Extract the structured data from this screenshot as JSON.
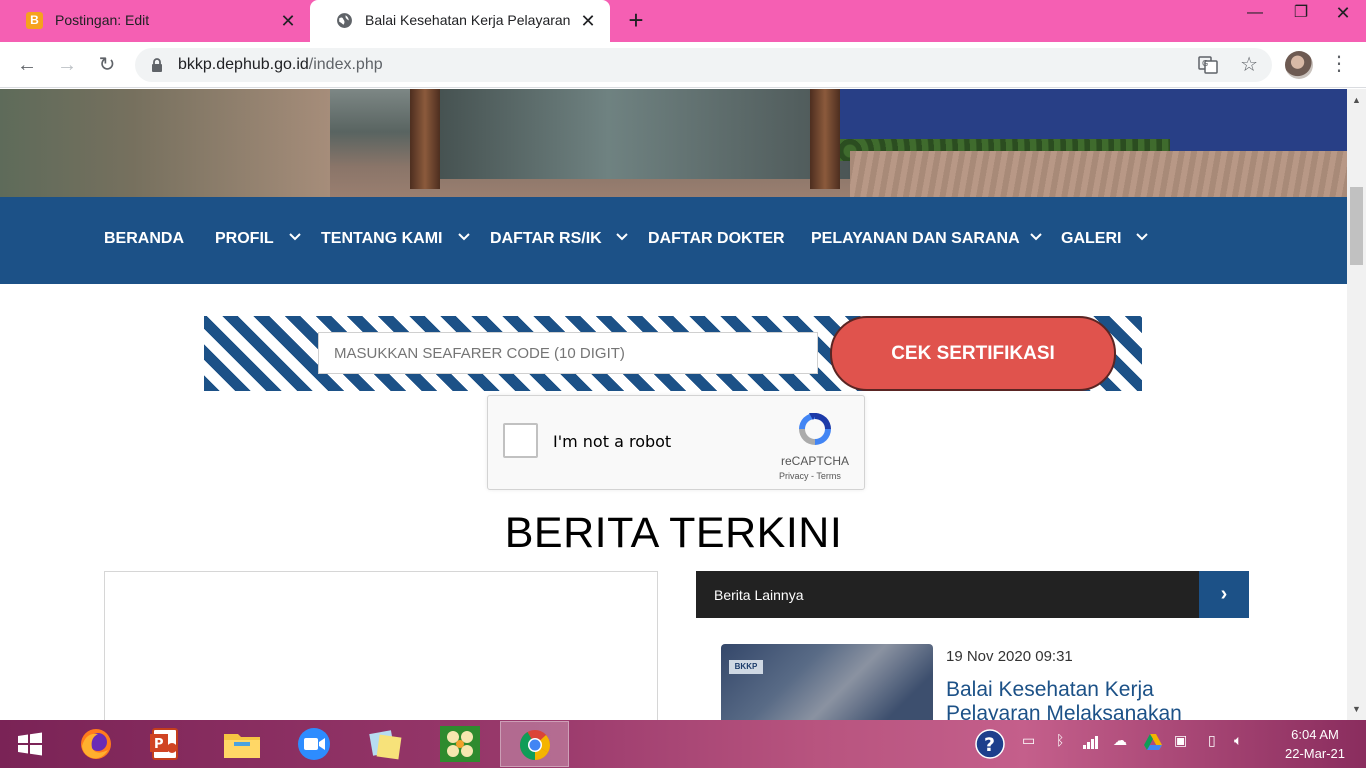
{
  "browser": {
    "tabs": [
      {
        "title": "Postingan: Edit",
        "icon": "blogger-icon",
        "active": false
      },
      {
        "title": "Balai Kesehatan Kerja Pelayaran",
        "icon": "globe-icon",
        "active": true
      }
    ],
    "url_host": "bkkp.dephub.go.id",
    "url_path": "/index.php"
  },
  "site": {
    "nav": [
      {
        "label": "BERANDA",
        "dropdown": false
      },
      {
        "label": "PROFIL",
        "dropdown": true
      },
      {
        "label": "TENTANG KAMI",
        "dropdown": true
      },
      {
        "label": "DAFTAR RS/IK",
        "dropdown": true
      },
      {
        "label": "DAFTAR DOKTER",
        "dropdown": false
      },
      {
        "label": "PELAYANAN DAN SARANA",
        "dropdown": true
      },
      {
        "label": "GALERI",
        "dropdown": true
      }
    ],
    "certificate": {
      "placeholder": "MASUKKAN SEAFARER CODE (10 DIGIT)",
      "button_label": "CEK SERTIFIKASI"
    },
    "recaptcha": {
      "label": "I'm not a robot",
      "brand": "reCAPTCHA",
      "privacy": "Privacy",
      "separator": " - ",
      "terms": "Terms"
    },
    "section_title": "BERITA TERKINI",
    "news_header": "Berita Lainnya",
    "news_items": [
      {
        "date": "19 Nov 2020 09:31",
        "title": "Balai Kesehatan Kerja Pelayaran Melaksanakan",
        "thumb_logo": "BKKP"
      }
    ]
  },
  "taskbar": {
    "apps": [
      "start-icon",
      "firefox-icon",
      "powerpoint-icon",
      "file-explorer-icon",
      "zoom-icon",
      "sticky-notes-icon",
      "photos-app-icon",
      "chrome-icon"
    ],
    "time": "6:04 AM",
    "date": "22-Mar-21"
  },
  "colors": {
    "tabstrip": "#f55fb3",
    "nav_blue": "#1c5187",
    "button_red": "#e0534d",
    "news_head": "#222222"
  }
}
